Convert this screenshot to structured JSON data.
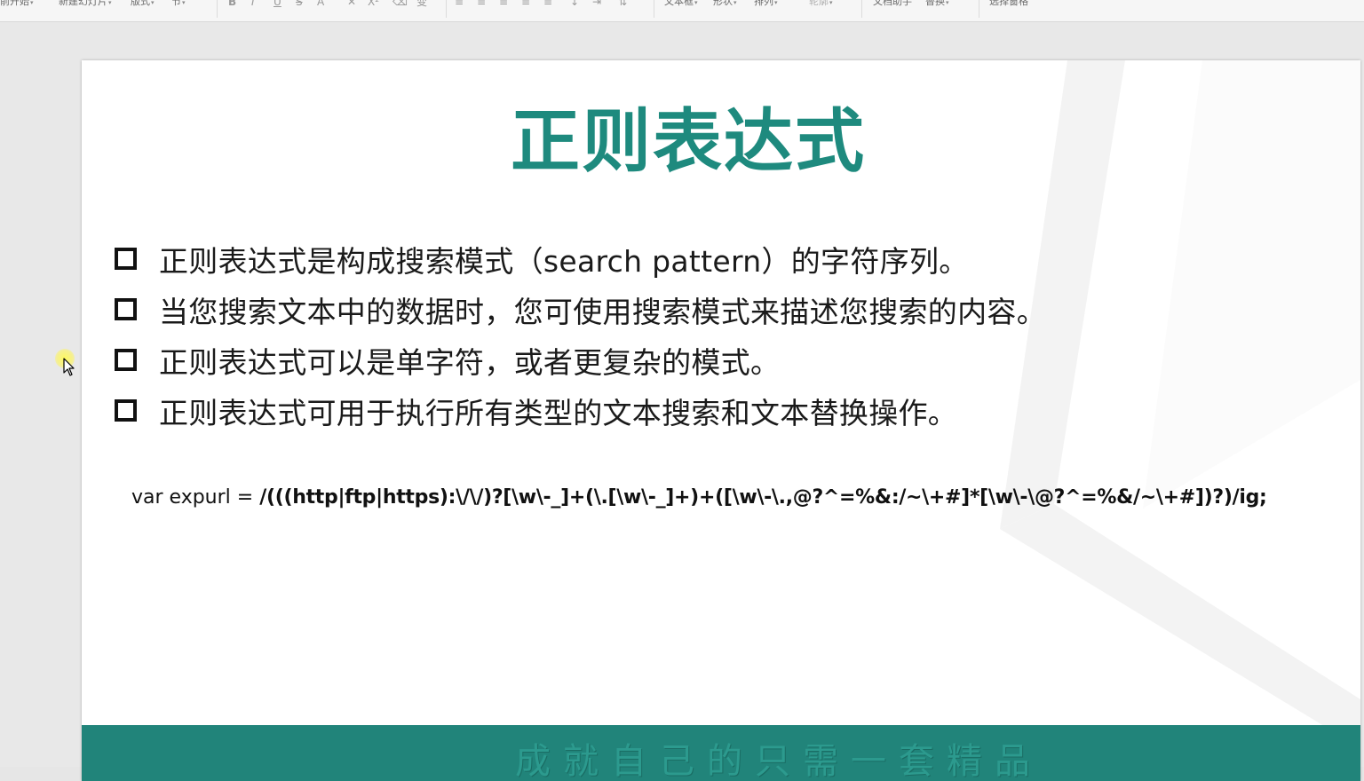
{
  "toolbar": {
    "items": [
      {
        "label": "前开始",
        "caret": "▾"
      },
      {
        "label": "新建幻灯片",
        "caret": "▾"
      },
      {
        "label": "版式",
        "caret": "▾"
      },
      {
        "label": "节",
        "caret": "▾"
      },
      {
        "label": "文本框",
        "caret": "▾"
      },
      {
        "label": "形状",
        "caret": "▾"
      },
      {
        "label": "排列",
        "caret": "▾"
      },
      {
        "label": "轮廓",
        "caret": "▾"
      },
      {
        "label": "文档助手",
        "caret": ""
      },
      {
        "label": "替换",
        "caret": "▾"
      },
      {
        "label": "选择窗格",
        "caret": ""
      }
    ],
    "icons": {
      "bold": "B",
      "italic": "I",
      "underline": "U",
      "strikethrough": "S",
      "font_color": "A",
      "clear_format": "✕",
      "superscript": "X²",
      "eraser": "⌫",
      "change_case": "变",
      "align_left": "≡",
      "align_center": "≡",
      "align_right": "≡",
      "justify": "≡",
      "distribute": "≡",
      "line_spacing": "↕",
      "indent": "⇥",
      "text_direction": "⇅"
    }
  },
  "slide": {
    "title": "正则表达式",
    "bullets": [
      "正则表达式是构成搜索模式（search pattern）的字符序列。",
      "当您搜索文本中的数据时，您可使用搜索模式来描述您搜索的内容。",
      "正则表达式可以是单字符，或者更复杂的模式。",
      "正则表达式可用于执行所有类型的文本搜索和文本替换操作。"
    ],
    "code_prefix": "var expurl = ",
    "code_regex": "/(((http|ftp|https):\\/\\/)?[\\w\\-_]+(\\.[\\w\\-_]+)+([\\w\\-\\.,@?^=%&:/~\\+#]*[\\w\\-\\@?^=%&/~\\+#])?)/ig;",
    "footer_text": "成就自己的只需一套精品"
  },
  "colors": {
    "title": "#1e8a7e",
    "footer_band": "#21847a",
    "footer_text": "#2c9a8e",
    "canvas_bg": "#e8e8e8"
  }
}
